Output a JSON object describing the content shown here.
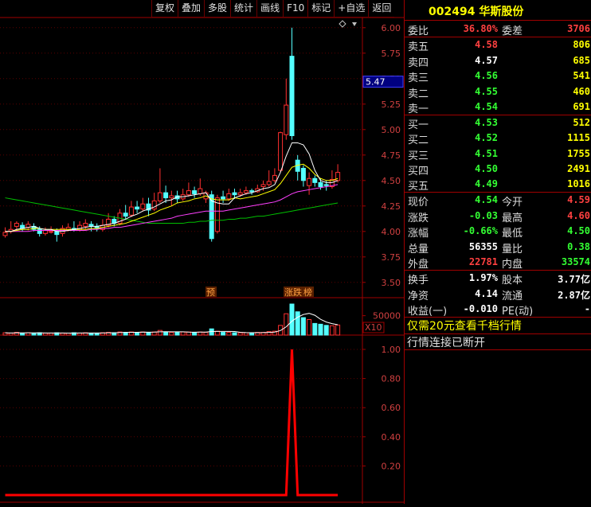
{
  "toolbar": [
    "复权",
    "叠加",
    "多股",
    "统计",
    "画线",
    "F10",
    "标记",
    "+自选",
    "返回"
  ],
  "stock": {
    "code": "002494",
    "name": "华斯股份"
  },
  "weibi": {
    "label1": "委比",
    "val1": "36.80%",
    "label2": "委差",
    "val2": "3706"
  },
  "asks": [
    {
      "label": "卖五",
      "price": "4.58",
      "vol": "806",
      "pc": "red"
    },
    {
      "label": "卖四",
      "price": "4.57",
      "vol": "685",
      "pc": "white"
    },
    {
      "label": "卖三",
      "price": "4.56",
      "vol": "541",
      "pc": "green"
    },
    {
      "label": "卖二",
      "price": "4.55",
      "vol": "460",
      "pc": "green"
    },
    {
      "label": "卖一",
      "price": "4.54",
      "vol": "691",
      "pc": "green"
    }
  ],
  "bids": [
    {
      "label": "买一",
      "price": "4.53",
      "vol": "512",
      "pc": "green"
    },
    {
      "label": "买二",
      "price": "4.52",
      "vol": "1115",
      "pc": "green"
    },
    {
      "label": "买三",
      "price": "4.51",
      "vol": "1755",
      "pc": "green"
    },
    {
      "label": "买四",
      "price": "4.50",
      "vol": "2491",
      "pc": "green"
    },
    {
      "label": "买五",
      "price": "4.49",
      "vol": "1016",
      "pc": "green"
    }
  ],
  "quote": [
    {
      "l1": "现价",
      "v1": "4.54",
      "c1": "green",
      "l2": "今开",
      "v2": "4.59",
      "c2": "red"
    },
    {
      "l1": "涨跌",
      "v1": "-0.03",
      "c1": "green",
      "l2": "最高",
      "v2": "4.60",
      "c2": "red"
    },
    {
      "l1": "涨幅",
      "v1": "-0.66%",
      "c1": "green",
      "l2": "最低",
      "v2": "4.50",
      "c2": "green"
    },
    {
      "l1": "总量",
      "v1": "56355",
      "c1": "white",
      "l2": "量比",
      "v2": "0.38",
      "c2": "green"
    },
    {
      "l1": "外盘",
      "v1": "22781",
      "c1": "red",
      "l2": "内盘",
      "v2": "33574",
      "c2": "green"
    }
  ],
  "finance": [
    {
      "l1": "换手",
      "v1": "1.97%",
      "l2": "股本",
      "v2": "3.77亿"
    },
    {
      "l1": "净资",
      "v1": "4.14",
      "l2": "流通",
      "v2": "2.87亿"
    },
    {
      "l1": "收益(一)",
      "v1": "-0.010",
      "l2": "PE(动)",
      "v2": "-"
    }
  ],
  "notice1": "仅需20元查看千档行情",
  "notice2": "行情连接已断开",
  "price_axis": [
    "6.00",
    "5.75",
    "5.50",
    "5.25",
    "5.00",
    "4.75",
    "4.50",
    "4.25",
    "4.00",
    "3.75",
    "3.50"
  ],
  "current_price_tag": "5.47",
  "vol_axis": "50000",
  "vol_unit": "X10",
  "ind_axis": [
    "1.00",
    "0.80",
    "0.60",
    "0.40",
    "0.20"
  ],
  "markers": [
    "预",
    "涨跌",
    "榜"
  ],
  "chart_data": {
    "type": "candlestick",
    "candles": [
      [
        3.96,
        3.99,
        4.04,
        3.94
      ],
      [
        4.0,
        4.02,
        4.1,
        3.98
      ],
      [
        4.05,
        4.08,
        4.1,
        4.02
      ],
      [
        4.06,
        4.03,
        4.09,
        4.0
      ],
      [
        4.04,
        4.07,
        4.1,
        4.01
      ],
      [
        4.05,
        4.02,
        4.08,
        4.0
      ],
      [
        4.02,
        3.98,
        4.05,
        3.95
      ],
      [
        3.98,
        4.01,
        4.04,
        3.96
      ],
      [
        4.0,
        4.0,
        4.05,
        3.98
      ],
      [
        4.0,
        3.97,
        4.03,
        3.9
      ],
      [
        3.98,
        4.03,
        4.06,
        3.95
      ],
      [
        4.02,
        4.04,
        4.08,
        4.0
      ],
      [
        4.03,
        4.01,
        4.1,
        4.0
      ],
      [
        4.01,
        4.06,
        4.1,
        4.0
      ],
      [
        4.05,
        4.08,
        4.12,
        4.02
      ],
      [
        4.07,
        4.05,
        4.1,
        4.0
      ],
      [
        4.05,
        4.03,
        4.08,
        4.0
      ],
      [
        4.02,
        4.06,
        4.12,
        4.0
      ],
      [
        4.06,
        4.12,
        4.18,
        4.04
      ],
      [
        4.12,
        4.08,
        4.15,
        4.05
      ],
      [
        4.08,
        4.18,
        4.22,
        4.06
      ],
      [
        4.18,
        4.15,
        4.26,
        4.12
      ],
      [
        4.16,
        4.24,
        4.3,
        4.14
      ],
      [
        4.24,
        4.22,
        4.3,
        4.18
      ],
      [
        4.22,
        4.27,
        4.33,
        4.2
      ],
      [
        4.27,
        4.21,
        4.33,
        4.15
      ],
      [
        4.22,
        4.3,
        4.38,
        4.2
      ],
      [
        4.3,
        4.38,
        4.62,
        4.28
      ],
      [
        4.38,
        4.33,
        4.45,
        4.28
      ],
      [
        4.33,
        4.35,
        4.4,
        4.25
      ],
      [
        4.35,
        4.32,
        4.4,
        4.28
      ],
      [
        4.32,
        4.36,
        4.42,
        4.3
      ],
      [
        4.36,
        4.4,
        4.48,
        4.34
      ],
      [
        4.4,
        4.37,
        4.44,
        4.33
      ],
      [
        4.37,
        4.42,
        4.52,
        4.35
      ],
      [
        4.32,
        4.38,
        4.4,
        4.28
      ],
      [
        4.36,
        3.93,
        4.4,
        3.9
      ],
      [
        4.0,
        4.33,
        4.36,
        3.98
      ],
      [
        4.34,
        4.32,
        4.4,
        4.28
      ],
      [
        4.32,
        4.37,
        4.42,
        4.3
      ],
      [
        4.38,
        4.36,
        4.42,
        4.32
      ],
      [
        4.36,
        4.38,
        4.42,
        4.34
      ],
      [
        4.38,
        4.4,
        4.44,
        4.36
      ],
      [
        4.4,
        4.39,
        4.42,
        4.36
      ],
      [
        4.39,
        4.42,
        4.46,
        4.38
      ],
      [
        4.44,
        4.46,
        4.5,
        4.4
      ],
      [
        4.46,
        4.49,
        4.6,
        4.44
      ],
      [
        4.5,
        4.55,
        4.62,
        4.48
      ],
      [
        4.6,
        4.97,
        4.98,
        4.58
      ],
      [
        4.95,
        5.24,
        5.5,
        4.9
      ],
      [
        5.72,
        4.94,
        6.0,
        4.9
      ],
      [
        4.7,
        4.59,
        4.75,
        4.5
      ],
      [
        4.62,
        4.5,
        4.65,
        4.44
      ],
      [
        4.45,
        4.52,
        4.58,
        4.36
      ],
      [
        4.52,
        4.48,
        4.55,
        4.44
      ],
      [
        4.48,
        4.44,
        4.52,
        4.41
      ],
      [
        4.46,
        4.45,
        4.5,
        4.4
      ],
      [
        4.44,
        4.51,
        4.6,
        4.42
      ],
      [
        4.5,
        4.58,
        4.66,
        4.48
      ]
    ],
    "ma5": [
      4.0,
      4.0,
      4.02,
      4.03,
      4.04,
      4.05,
      4.03,
      4.02,
      4.02,
      4.0,
      4.0,
      4.01,
      4.02,
      4.03,
      4.04,
      4.05,
      4.05,
      4.06,
      4.07,
      4.08,
      4.1,
      4.12,
      4.15,
      4.17,
      4.2,
      4.22,
      4.24,
      4.27,
      4.3,
      4.31,
      4.34,
      4.34,
      4.35,
      4.36,
      4.37,
      4.38,
      4.3,
      4.28,
      4.27,
      4.27,
      4.33,
      4.35,
      4.37,
      4.38,
      4.4,
      4.42,
      4.43,
      4.46,
      4.58,
      4.74,
      4.87,
      4.87,
      4.85,
      4.76,
      4.6,
      4.5,
      4.48,
      4.48,
      4.5
    ],
    "ma10": [
      4.0,
      4.0,
      4.01,
      4.02,
      4.02,
      4.03,
      4.03,
      4.02,
      4.02,
      4.02,
      4.02,
      4.02,
      4.02,
      4.02,
      4.02,
      4.03,
      4.03,
      4.04,
      4.05,
      4.06,
      4.07,
      4.08,
      4.1,
      4.12,
      4.14,
      4.16,
      4.18,
      4.21,
      4.23,
      4.25,
      4.28,
      4.29,
      4.3,
      4.32,
      4.33,
      4.35,
      4.32,
      4.31,
      4.31,
      4.31,
      4.33,
      4.32,
      4.33,
      4.34,
      4.35,
      4.37,
      4.39,
      4.41,
      4.47,
      4.55,
      4.63,
      4.65,
      4.66,
      4.62,
      4.56,
      4.52,
      4.5,
      4.5,
      4.52
    ],
    "ma20": [
      4.0,
      4.0,
      4.0,
      4.0,
      4.0,
      4.01,
      4.01,
      4.01,
      4.01,
      4.01,
      4.01,
      4.01,
      4.01,
      4.01,
      4.01,
      4.02,
      4.02,
      4.03,
      4.03,
      4.04,
      4.04,
      4.05,
      4.06,
      4.07,
      4.08,
      4.09,
      4.1,
      4.11,
      4.12,
      4.13,
      4.15,
      4.16,
      4.17,
      4.18,
      4.19,
      4.2,
      4.2,
      4.2,
      4.2,
      4.21,
      4.22,
      4.23,
      4.24,
      4.25,
      4.26,
      4.27,
      4.28,
      4.29,
      4.31,
      4.34,
      4.37,
      4.39,
      4.4,
      4.41,
      4.42,
      4.43,
      4.44,
      4.45,
      4.46
    ],
    "ma60": [
      4.33,
      4.32,
      4.31,
      4.3,
      4.29,
      4.28,
      4.27,
      4.26,
      4.25,
      4.24,
      4.23,
      4.22,
      4.21,
      4.2,
      4.19,
      4.18,
      4.17,
      4.16,
      4.15,
      4.14,
      4.13,
      4.12,
      4.11,
      4.1,
      4.09,
      4.08,
      4.08,
      4.08,
      4.08,
      4.08,
      4.08,
      4.08,
      4.09,
      4.09,
      4.1,
      4.1,
      4.11,
      4.11,
      4.11,
      4.12,
      4.12,
      4.13,
      4.13,
      4.14,
      4.15,
      4.15,
      4.16,
      4.17,
      4.18,
      4.19,
      4.2,
      4.21,
      4.22,
      4.23,
      4.24,
      4.25,
      4.26,
      4.27,
      4.28
    ],
    "volumes": [
      6,
      5,
      7,
      5,
      6,
      5,
      6,
      5,
      5,
      6,
      5,
      5,
      6,
      5,
      6,
      5,
      5,
      6,
      7,
      6,
      8,
      7,
      8,
      7,
      8,
      7,
      8,
      12,
      8,
      7,
      7,
      8,
      8,
      7,
      8,
      7,
      16,
      10,
      7,
      7,
      6,
      6,
      6,
      6,
      7,
      7,
      9,
      10,
      25,
      55,
      80,
      60,
      45,
      40,
      30,
      28,
      25,
      24,
      26
    ],
    "indicator": {
      "peak_index": 50,
      "values_range": [
        0,
        1
      ]
    },
    "ylim": [
      3.35,
      6.1
    ]
  }
}
